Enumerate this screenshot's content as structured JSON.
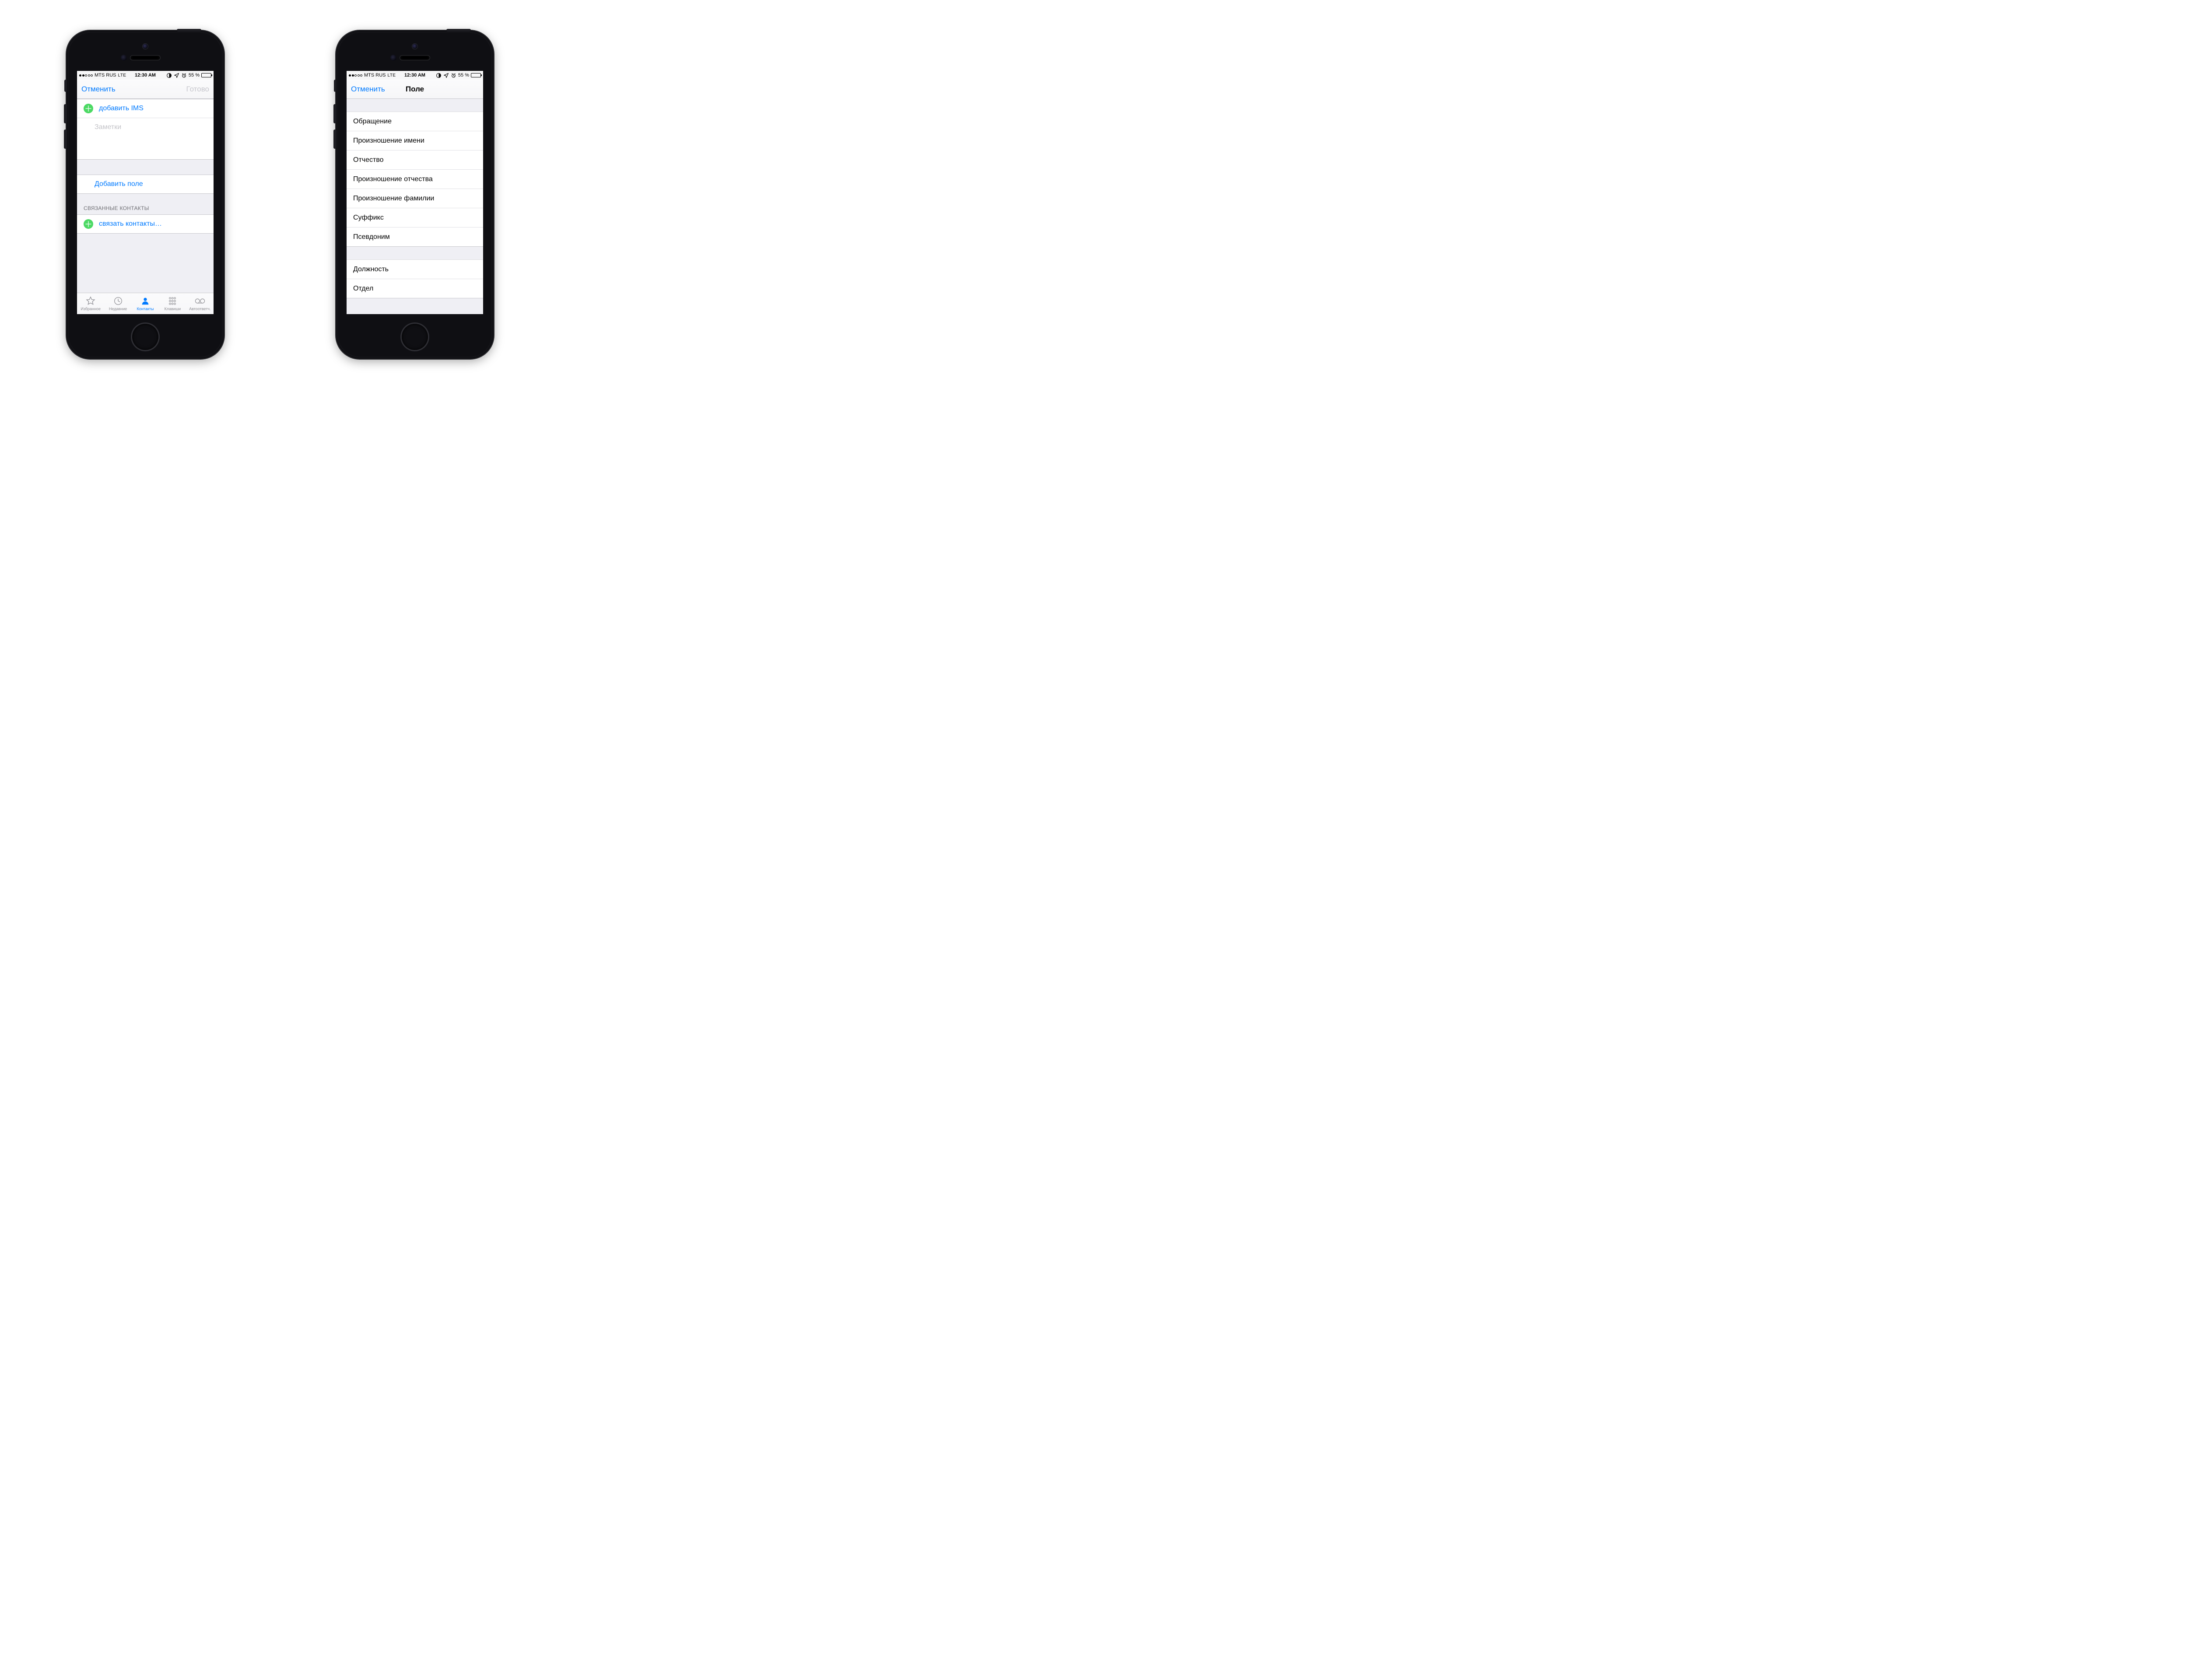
{
  "status": {
    "carrier": "MTS RUS",
    "dataMode": "LTE",
    "time": "12:30 AM",
    "batteryPercent": "55 %"
  },
  "left": {
    "nav": {
      "cancel": "Отменить",
      "done": "Готово"
    },
    "addIMS": "добавить IMS",
    "notesPlaceholder": "Заметки",
    "addField": "Добавить поле",
    "linkedHeader": "СВЯЗАННЫЕ КОНТАКТЫ",
    "linkContacts": "связать контакты…",
    "tabs": {
      "favorites": "Избранное",
      "recents": "Недавние",
      "contacts": "Контакты",
      "keypad": "Клавиши",
      "voicemail": "Автоответч."
    }
  },
  "right": {
    "nav": {
      "cancel": "Отменить",
      "title": "Поле"
    },
    "group1": [
      "Обращение",
      "Произношение имени",
      "Отчество",
      "Произношение отчества",
      "Произношение фамилии",
      "Суффикс",
      "Псевдоним"
    ],
    "group2": [
      "Должность",
      "Отдел"
    ]
  }
}
